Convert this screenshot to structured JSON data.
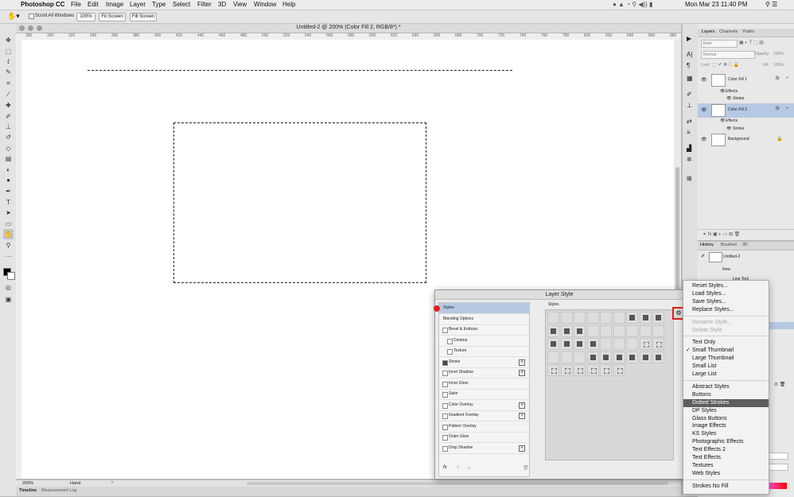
{
  "menubar": {
    "apple_icon": "",
    "app_name": "Photoshop CC",
    "menus": [
      "File",
      "Edit",
      "Image",
      "Layer",
      "Type",
      "Select",
      "Filter",
      "3D",
      "View",
      "Window",
      "Help"
    ],
    "clock": "Mon Mar 23  11:40 PM"
  },
  "options_bar": {
    "scroll_all_windows": "Scroll All Windows",
    "zoom_button": "100%",
    "fit_screen": "Fit Screen",
    "fill_screen": "Fill Screen"
  },
  "document": {
    "title": "Untitled-2 @ 200% (Color Fill 2, RGB/8*) *",
    "ruler_ticks": [
      "280",
      "300",
      "320",
      "340",
      "360",
      "380",
      "400",
      "420",
      "440",
      "460",
      "480",
      "500",
      "520",
      "540",
      "560",
      "580",
      "600",
      "620",
      "640",
      "660",
      "680",
      "700",
      "720",
      "740",
      "760",
      "780",
      "800",
      "820",
      "840",
      "860",
      "880"
    ],
    "zoom": "200%",
    "status_tool": "Hand"
  },
  "bottom_tabs": [
    "Timeline",
    "Measurement Log"
  ],
  "layers_panel": {
    "tabs": [
      "Layers",
      "Channels",
      "Paths"
    ],
    "kind_placeholder": "Kind",
    "blend_mode": "Normal",
    "opacity_label": "Opacity:",
    "opacity_value": "100%",
    "lock_label": "Lock:",
    "fill_label": "Fill:",
    "fill_value": "100%",
    "layers": [
      {
        "name": "Color Fill 1",
        "fx": "fx",
        "effects": "Effects",
        "stroke": "Stroke",
        "selected": false
      },
      {
        "name": "Color Fill 2",
        "fx": "fx",
        "effects": "Effects",
        "stroke": "Stroke",
        "selected": true
      },
      {
        "name": "Background"
      }
    ]
  },
  "history_panel": {
    "tabs": [
      "History",
      "Brushes",
      "3D"
    ],
    "items": [
      "Untitled-2",
      "New",
      "Line Tool"
    ]
  },
  "layer_style_dialog": {
    "title": "Layer Style",
    "left_items": [
      {
        "label": "Styles",
        "checkbox": false,
        "plus": false,
        "selected": true
      },
      {
        "label": "Blending Options",
        "checkbox": false,
        "plus": false
      },
      {
        "label": "Bevel & Emboss",
        "checkbox": true,
        "checked": false,
        "plus": false
      },
      {
        "label": "Contour",
        "checkbox": true,
        "checked": false,
        "plus": false,
        "indent": true
      },
      {
        "label": "Texture",
        "checkbox": true,
        "checked": false,
        "plus": false,
        "indent": true
      },
      {
        "label": "Stroke",
        "checkbox": true,
        "checked": true,
        "plus": true
      },
      {
        "label": "Inner Shadow",
        "checkbox": true,
        "checked": false,
        "plus": true
      },
      {
        "label": "Inner Glow",
        "checkbox": true,
        "checked": false,
        "plus": false
      },
      {
        "label": "Satin",
        "checkbox": true,
        "checked": false,
        "plus": false
      },
      {
        "label": "Color Overlay",
        "checkbox": true,
        "checked": false,
        "plus": true
      },
      {
        "label": "Gradient Overlay",
        "checkbox": true,
        "checked": false,
        "plus": true
      },
      {
        "label": "Pattern Overlay",
        "checkbox": true,
        "checked": false,
        "plus": false
      },
      {
        "label": "Outer Glow",
        "checkbox": true,
        "checked": false,
        "plus": false
      },
      {
        "label": "Drop Shadow",
        "checkbox": true,
        "checked": false,
        "plus": true
      }
    ],
    "styles_label": "Styles",
    "fx_label": "fx",
    "swatch_rows": [
      [
        "e",
        "e",
        "e",
        "e",
        "e",
        "e",
        "f",
        "f",
        "f"
      ],
      [
        "f",
        "f",
        "f",
        "e",
        "e",
        "e",
        "e",
        "e",
        "e"
      ],
      [
        "f",
        "f",
        "f",
        "f",
        "e",
        "e",
        "e",
        "o",
        "o"
      ],
      [
        "e",
        "e",
        "e",
        "f",
        "f",
        "f",
        "f",
        "f",
        "f"
      ],
      [
        "o",
        "o",
        "o",
        "o",
        "o",
        "o"
      ]
    ]
  },
  "style_menu": {
    "groups": [
      [
        {
          "label": "Reset Styles..."
        },
        {
          "label": "Load Styles..."
        },
        {
          "label": "Save Styles..."
        },
        {
          "label": "Replace Styles..."
        }
      ],
      [
        {
          "label": "Rename Style...",
          "disabled": true
        },
        {
          "label": "Delete Style",
          "disabled": true
        }
      ],
      [
        {
          "label": "Text Only"
        },
        {
          "label": "Small Thumbnail",
          "checked": true
        },
        {
          "label": "Large Thumbnail"
        },
        {
          "label": "Small List"
        },
        {
          "label": "Large List"
        }
      ],
      [
        {
          "label": "Abstract Styles"
        },
        {
          "label": "Buttons"
        },
        {
          "label": "Dotted Strokes",
          "highlighted": true
        },
        {
          "label": "DP Styles"
        },
        {
          "label": "Glass Buttons"
        },
        {
          "label": "Image Effects"
        },
        {
          "label": "KS Styles"
        },
        {
          "label": "Photographic Effects"
        },
        {
          "label": "Text Effects 2"
        },
        {
          "label": "Text Effects"
        },
        {
          "label": "Textures"
        },
        {
          "label": "Web Styles"
        }
      ],
      [
        {
          "label": "Strokes No Fill"
        }
      ]
    ],
    "check_mark": "✓"
  },
  "colors": {
    "selection_blue": "#b6c9e3",
    "highlight_gray": "#5d5d5d",
    "red_marker": "#e0201c"
  }
}
